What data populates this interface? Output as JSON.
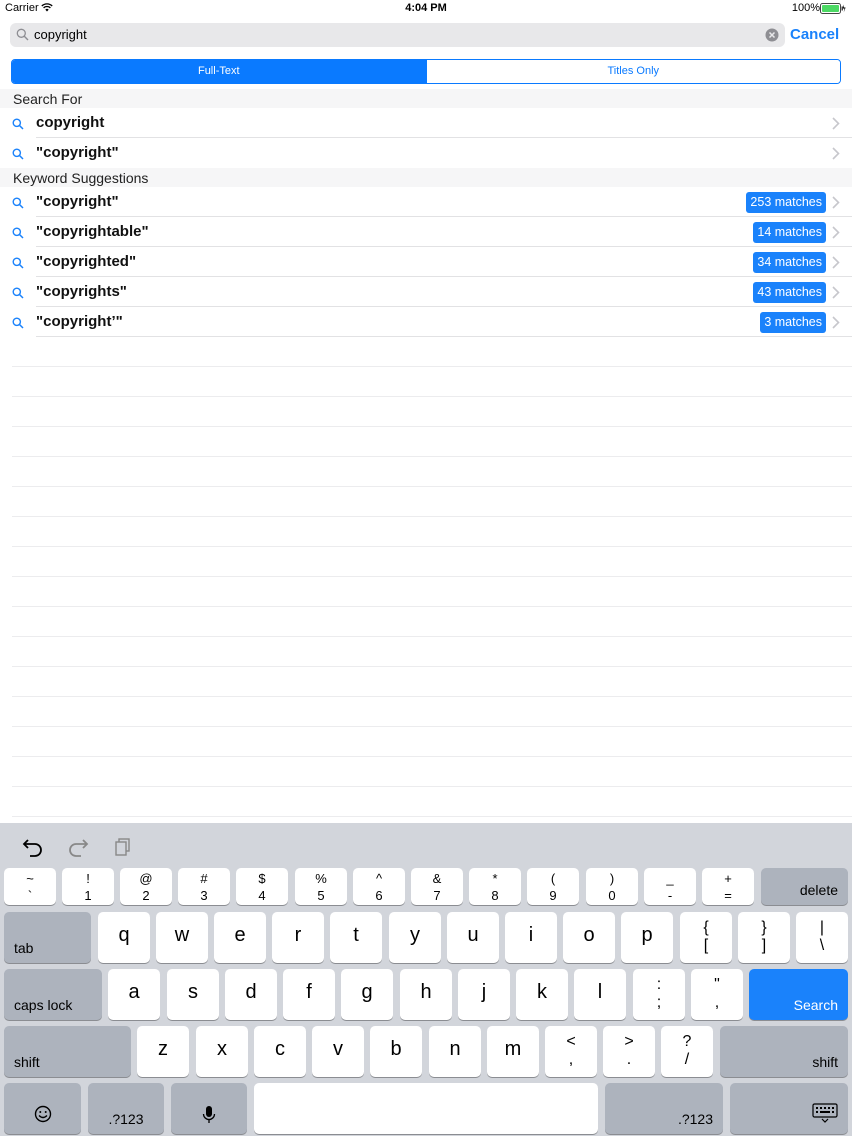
{
  "status_bar": {
    "carrier": "Carrier",
    "time": "4:04 PM",
    "battery": "100%"
  },
  "search": {
    "query": "copyright",
    "cancel_label": "Cancel"
  },
  "segments": [
    "Full-Text",
    "Titles Only"
  ],
  "search_for": {
    "header": "Search For",
    "items": [
      "copyright",
      "\"copyright\""
    ]
  },
  "keyword_suggestions": {
    "header": "Keyword Suggestions",
    "items": [
      {
        "label": "\"copyright\"",
        "badge": "253 matches"
      },
      {
        "label": "\"copyrightable\"",
        "badge": "14 matches"
      },
      {
        "label": "\"copyrighted\"",
        "badge": "34 matches"
      },
      {
        "label": "\"copyrights\"",
        "badge": "43 matches"
      },
      {
        "label": "\"copyright’\"",
        "badge": "3 matches"
      }
    ]
  },
  "keyboard": {
    "number_row": [
      {
        "top": "~",
        "bot": "`"
      },
      {
        "top": "!",
        "bot": "1"
      },
      {
        "top": "@",
        "bot": "2"
      },
      {
        "top": "#",
        "bot": "3"
      },
      {
        "top": "$",
        "bot": "4"
      },
      {
        "top": "%",
        "bot": "5"
      },
      {
        "top": "^",
        "bot": "6"
      },
      {
        "top": "&",
        "bot": "7"
      },
      {
        "top": "*",
        "bot": "8"
      },
      {
        "top": "(",
        "bot": "9"
      },
      {
        "top": ")",
        "bot": "0"
      },
      {
        "top": "_",
        "bot": "-"
      },
      {
        "top": "+",
        "bot": "="
      }
    ],
    "delete": "delete",
    "tab": "tab",
    "row_q": [
      "q",
      "w",
      "e",
      "r",
      "t",
      "y",
      "u",
      "i",
      "o",
      "p"
    ],
    "row_q_sym": [
      {
        "top": "{",
        "bot": "["
      },
      {
        "top": "}",
        "bot": "]"
      },
      {
        "top": "|",
        "bot": "\\"
      }
    ],
    "caps_lock": "caps lock",
    "row_a": [
      "a",
      "s",
      "d",
      "f",
      "g",
      "h",
      "j",
      "k",
      "l"
    ],
    "row_a_sym": [
      {
        "top": ":",
        "bot": ";"
      },
      {
        "top": "\"",
        "bot": ","
      }
    ],
    "search_key": "Search",
    "shift": "shift",
    "row_z": [
      "z",
      "x",
      "c",
      "v",
      "b",
      "n",
      "m"
    ],
    "row_z_sym": [
      {
        "top": "<",
        "bot": ","
      },
      {
        "top": ">",
        "bot": "."
      },
      {
        "top": "?",
        "bot": "/"
      }
    ],
    "numbers_key": ".?123"
  }
}
